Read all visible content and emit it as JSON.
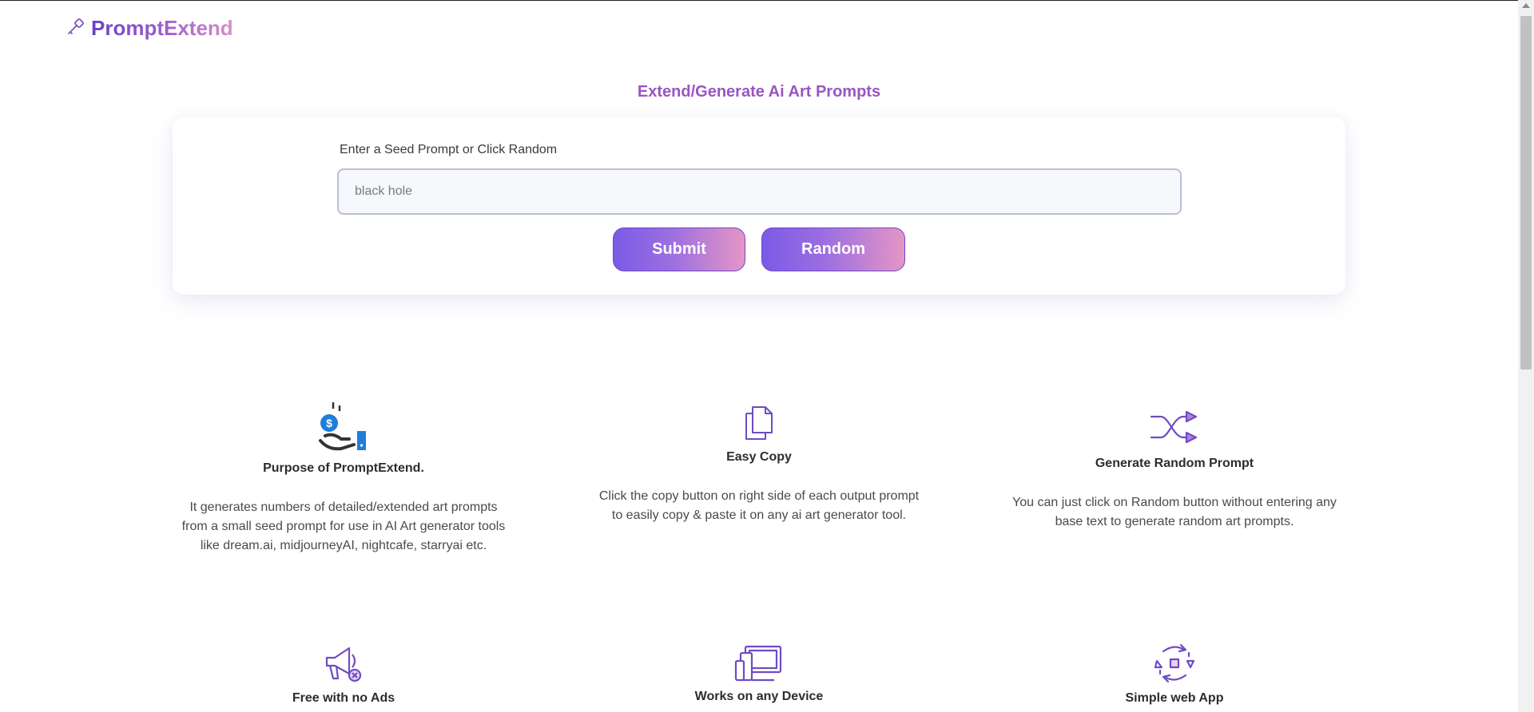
{
  "brand": {
    "name": "PromptExtend",
    "icon": "wand-icon"
  },
  "hero": {
    "title": "Extend/Generate Ai Art Prompts"
  },
  "form": {
    "label": "Enter a Seed Prompt or Click Random",
    "input_value": "",
    "input_placeholder": "black hole",
    "submit_label": "Submit",
    "random_label": "Random"
  },
  "features": [
    {
      "icon": "money-hand-icon",
      "title": "Purpose of PromptExtend.",
      "lines": [
        "It generates numbers of detailed/extended art prompts",
        "from a small seed prompt for use in AI Art generator tools",
        "like dream.ai, midjourneyAI, nightcafe, starryai etc."
      ]
    },
    {
      "icon": "copy-icon",
      "title": "Easy Copy",
      "lines": [
        "Click the copy button on right side of each output prompt",
        "to easily copy & paste it on any ai art generator tool."
      ]
    },
    {
      "icon": "shuffle-icon",
      "title": "Generate Random Prompt",
      "lines": [
        "You can just click on Random button without entering any",
        "base text to generate random art prompts."
      ]
    },
    {
      "icon": "megaphone-no-ads-icon",
      "title": "Free with no Ads",
      "lines": []
    },
    {
      "icon": "devices-icon",
      "title": "Works on any Device",
      "lines": []
    },
    {
      "icon": "simple-app-icon",
      "title": "Simple web App",
      "lines": []
    }
  ],
  "colors": {
    "brand_start": "#6a3fc9",
    "brand_end": "#d692c8",
    "title_purple": "#9a55c0",
    "button_start": "#7a5be6",
    "button_end": "#e496c4"
  }
}
